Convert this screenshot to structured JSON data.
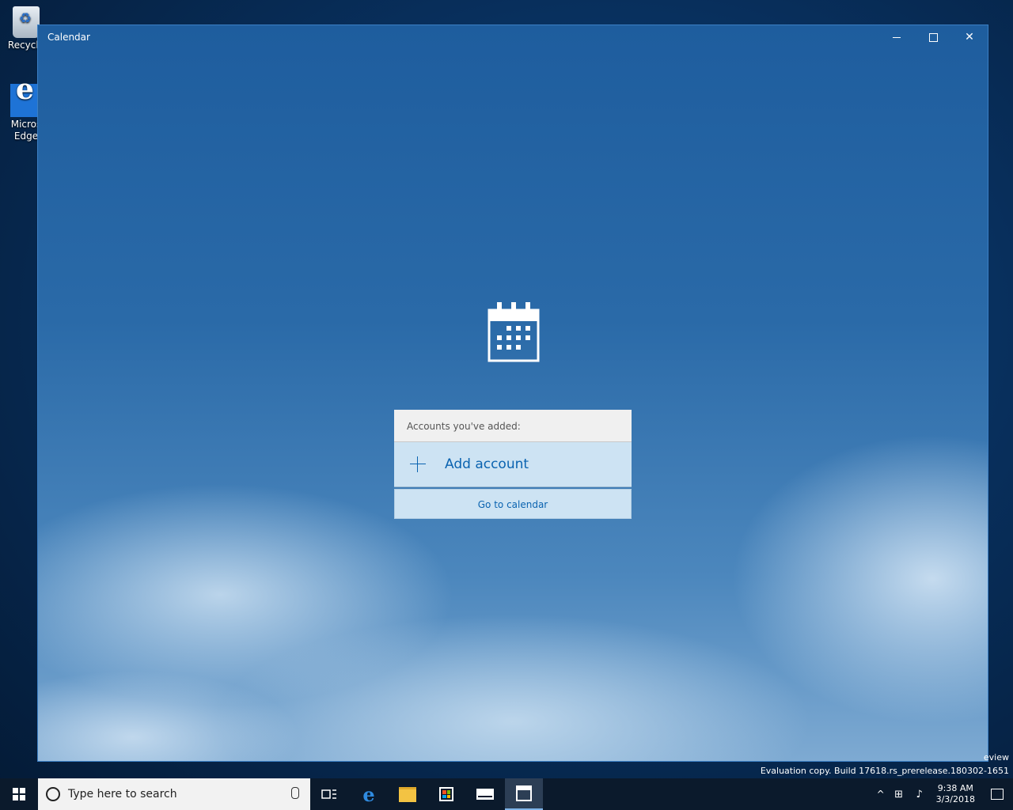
{
  "desktop": {
    "icons": [
      {
        "label": "Recycle"
      },
      {
        "label": "Micros Edge"
      }
    ]
  },
  "window": {
    "title": "Calendar",
    "controls": {
      "minimize": "minimize",
      "maximize": "maximize",
      "close": "✕"
    }
  },
  "accounts": {
    "header": "Accounts you've added:",
    "add_account": "Add account",
    "go_to_calendar": "Go to calendar"
  },
  "watermark": {
    "line1": "eview",
    "line2": "Evaluation copy. Build 17618.rs_prerelease.180302-1651"
  },
  "taskbar": {
    "search_placeholder": "Type here to search",
    "clock_time": "9:38 AM",
    "clock_date": "3/3/2018"
  },
  "colors": {
    "accent": "#0a63b0",
    "panel_light": "#cde3f3",
    "taskbar": "#0b1a2c"
  }
}
